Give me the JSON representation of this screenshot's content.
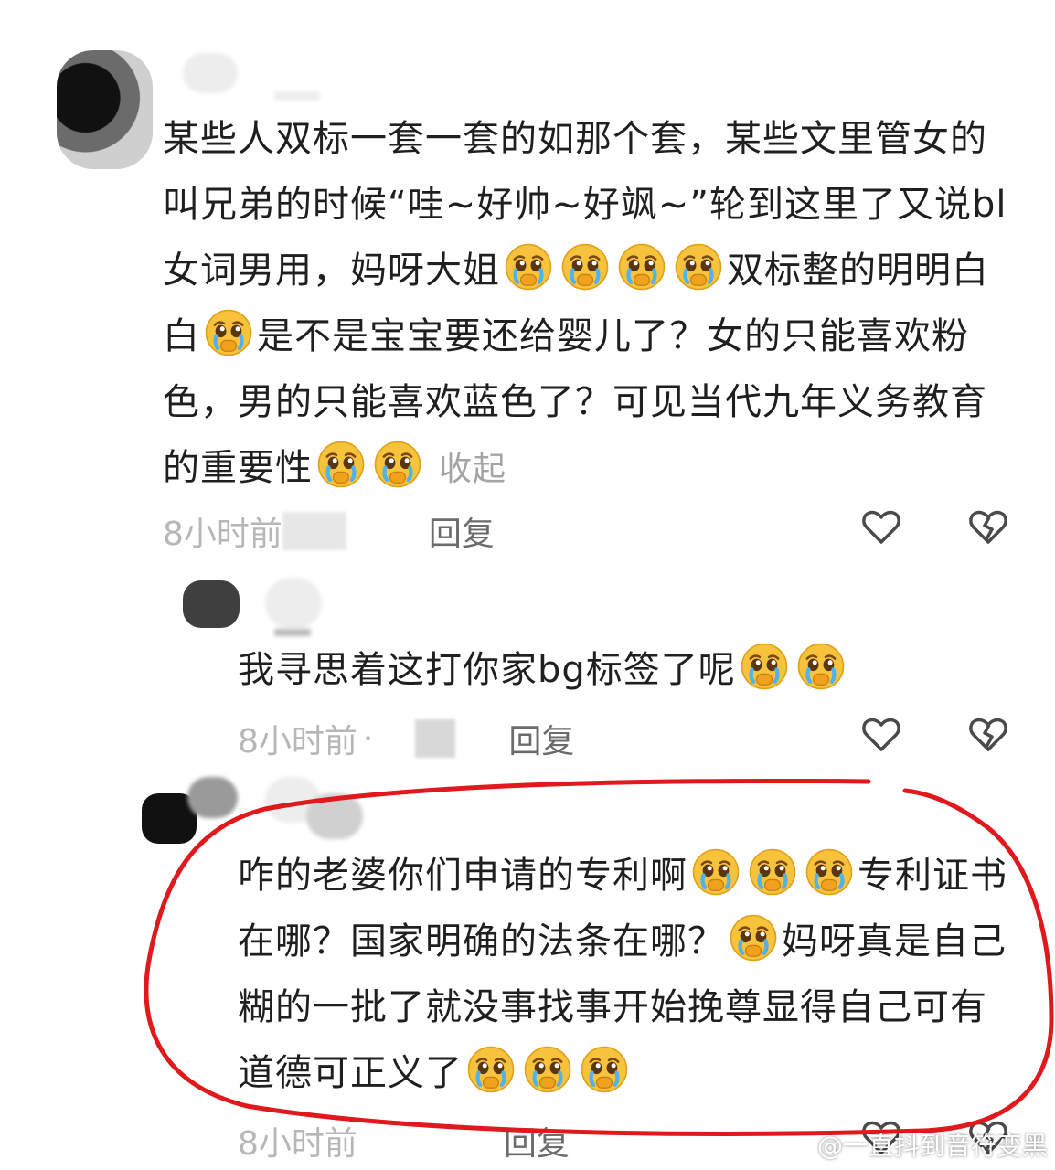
{
  "comments": [
    {
      "segments": [
        "某些人双标一套一套的如那个套，某些文里管女的叫兄弟的时候“哇~好帅~好飒~”轮到这里了又说bl女词男用，妈呀大姐",
        "双标整的明明白白",
        "是不是宝宝要还给婴儿了？女的只能喜欢粉色，男的只能喜欢蓝色了？可见当代九年义务教育的重要性"
      ],
      "collapse_label": "收起",
      "time": "8小时前",
      "reply_label": "回复"
    },
    {
      "segments": [
        "我寻思着这打你家bg标签了呢"
      ],
      "time": "8小时前",
      "dot": "·",
      "reply_label": "回复"
    },
    {
      "segments": [
        "咋的老婆你们申请的专利啊",
        "专利证书在哪？国家明确的法条在哪？",
        "妈呀真是自己糊的一批了就没事找事开始挽尊显得自己可有道德可正义了"
      ],
      "time": "8小时前",
      "reply_label": "回复"
    }
  ],
  "emoji_name": "crying-face-emoji",
  "icons": {
    "like": "heart-outline-icon",
    "dislike": "broken-heart-icon"
  },
  "colors": {
    "highlight": "#e0191d",
    "reply": "#6b6b6b",
    "time": "#b7b7b7"
  },
  "watermark": "@一直抖到音符变黑"
}
